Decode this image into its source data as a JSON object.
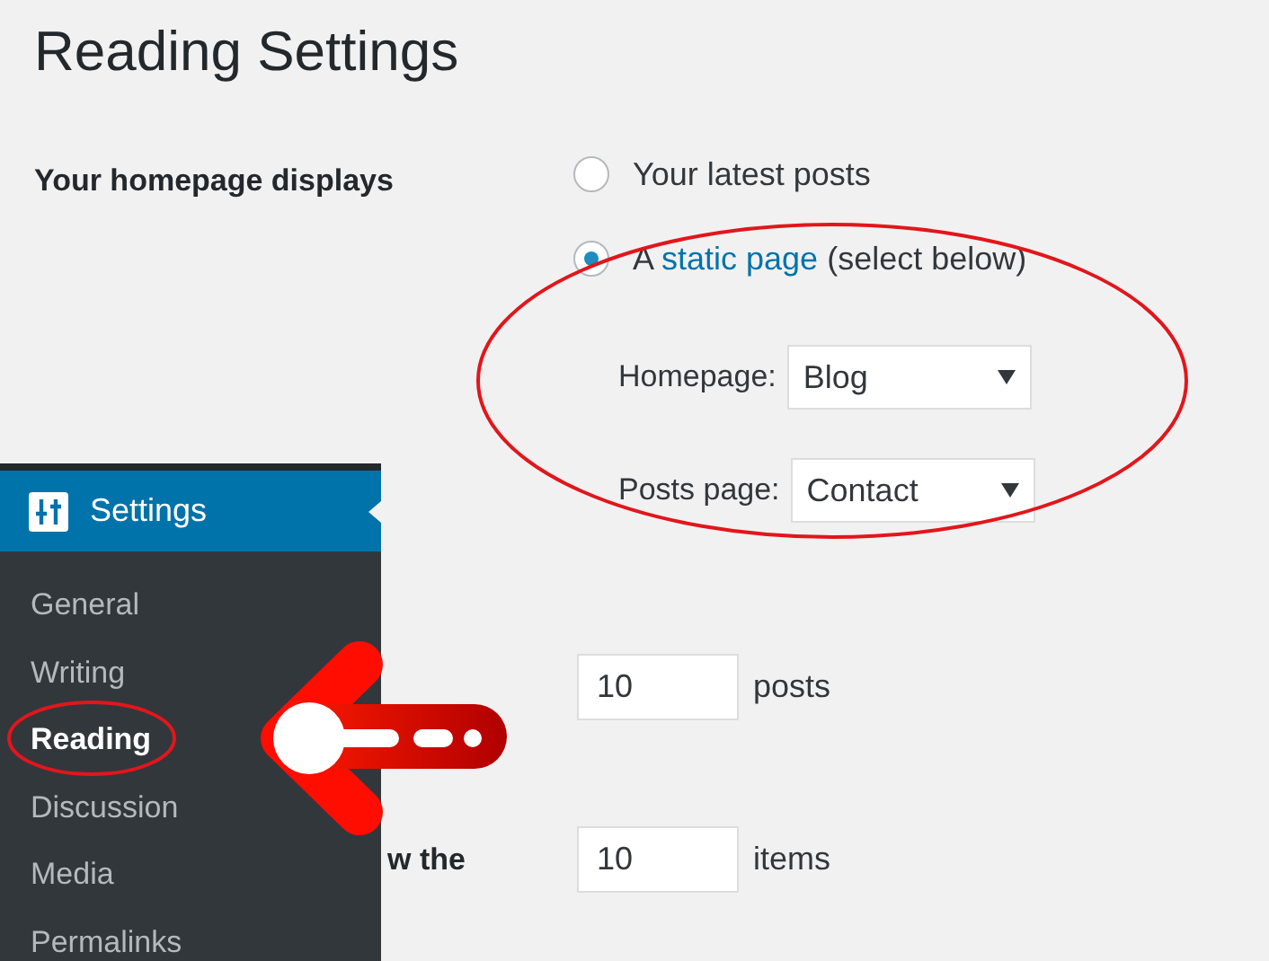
{
  "page": {
    "title": "Reading Settings"
  },
  "homepage_displays": {
    "label": "Your homepage displays",
    "options": [
      {
        "kind": "plain",
        "label": "Your latest posts",
        "selected": false
      },
      {
        "kind": "link",
        "prefix": "A ",
        "link": "static page",
        "suffix": " (select below)",
        "selected": true
      }
    ],
    "selects": [
      {
        "label": "Homepage:",
        "value": "Blog"
      },
      {
        "label": "Posts page:",
        "value": "Contact"
      }
    ]
  },
  "number_rows": [
    {
      "value": "10",
      "unit": "posts"
    },
    {
      "label": "w the",
      "value": "10",
      "unit": "items"
    }
  ],
  "sidebar": {
    "heading": "Settings",
    "items": [
      {
        "label": "General",
        "selected": false
      },
      {
        "label": "Writing",
        "selected": false
      },
      {
        "label": "Reading",
        "selected": true
      },
      {
        "label": "Discussion",
        "selected": false
      },
      {
        "label": "Media",
        "selected": false
      },
      {
        "label": "Permalinks",
        "selected": false
      }
    ]
  }
}
